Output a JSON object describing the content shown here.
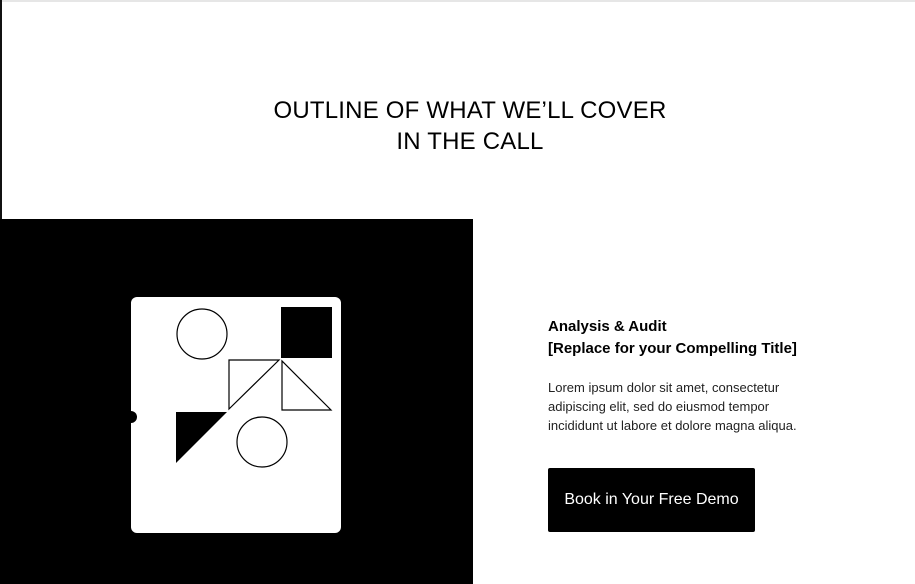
{
  "heading": {
    "line1": "OUTLINE OF WHAT WE’LL COVER",
    "line2": "IN THE CALL"
  },
  "section": {
    "title_line1": "Analysis & Audit",
    "title_line2": "[Replace for your Compelling Title]",
    "body": "Lorem ipsum dolor sit amet, consectetur adipiscing elit, sed do eiusmod tempor incididunt ut labore et dolore magna aliqua.",
    "cta_label": "Book in Your Free Demo"
  },
  "colors": {
    "panel": "#000000",
    "card": "#ffffff",
    "button": "#000000",
    "button_text": "#ffffff"
  },
  "illustration": {
    "icon": "geometric-shapes-illustration"
  }
}
